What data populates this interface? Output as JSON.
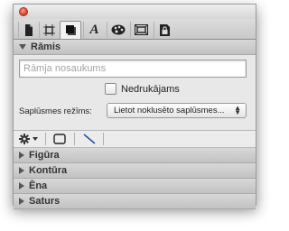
{
  "tabs": [
    {
      "icon": "document-icon"
    },
    {
      "icon": "canvas-icon"
    },
    {
      "icon": "shape-icon",
      "active": true
    },
    {
      "icon": "text-icon",
      "glyph": "A"
    },
    {
      "icon": "palette-icon"
    },
    {
      "icon": "image-frame-icon"
    },
    {
      "icon": "lock-icon"
    }
  ],
  "frame_section": {
    "title": "Rāmis",
    "name_placeholder": "Rāmja nosaukums",
    "nonprinting_label": "Nedrukājams",
    "blend_mode_label": "Saplūsmes režīms:",
    "blend_mode_value": "Lietot noklusēto saplūsmes..."
  },
  "sections": [
    {
      "title": "Figūra"
    },
    {
      "title": "Kontūra"
    },
    {
      "title": "Ēna"
    },
    {
      "title": "Saturs"
    }
  ]
}
